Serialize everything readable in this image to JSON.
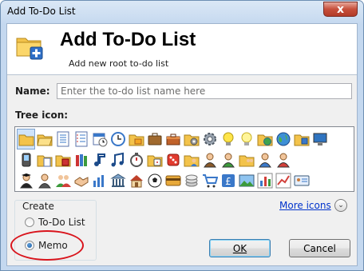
{
  "window": {
    "title": "Add To-Do List",
    "close_glyph": "x"
  },
  "header": {
    "title": "Add To-Do List",
    "subtitle": "Add new root to-do list",
    "icon": "folder-add-icon"
  },
  "form": {
    "name_label": "Name:",
    "name_value": "",
    "name_placeholder": "Enter the to-do list name here",
    "tree_icon_label": "Tree icon:"
  },
  "icon_grid": {
    "selected_index": 0,
    "icons": [
      "folder-icon",
      "folder-open-icon",
      "document-list-icon",
      "numbered-list-icon",
      "calendar-clock-icon",
      "clock-icon",
      "folder-yellow-icon",
      "briefcase-icon",
      "toolbox-icon",
      "folder-gear-icon",
      "gear-icon",
      "lightbulb-on-icon",
      "lightbulb-icon",
      "folder-globe-icon",
      "globe-icon",
      "folder-cube-icon",
      "monitor-icon",
      "spacer",
      "pda-icon",
      "folder-document-icon",
      "folder-book-icon",
      "books-icon",
      "music-note-icon",
      "music-notes-icon",
      "stopwatch-icon",
      "folder-dice-icon",
      "dice-icon",
      "folder-person-icon",
      "person-icon",
      "person-green-icon",
      "folder-people-icon",
      "person-blue-icon",
      "person-red-icon",
      "spacer",
      "spacer",
      "spacer",
      "graduate-icon",
      "person-dark-icon",
      "people-group-icon",
      "handshake-icon",
      "chart-people-icon",
      "bank-icon",
      "house-icon",
      "soccer-ball-icon",
      "credit-card-icon",
      "coins-icon",
      "shopping-cart-icon",
      "pound-icon",
      "landscape-icon",
      "bar-chart-icon",
      "line-chart-icon",
      "id-card-icon",
      "spacer",
      "spacer"
    ]
  },
  "create": {
    "group_label": "Create",
    "options": [
      {
        "label": "To-Do List",
        "checked": false
      },
      {
        "label": "Memo",
        "checked": true
      }
    ]
  },
  "more_icons": {
    "label": "More icons",
    "icon": "chevron-down-circle-icon"
  },
  "buttons": {
    "ok": "OK",
    "cancel": "Cancel"
  },
  "colors": {
    "accent": "#0033cc",
    "highlight": "#d9141c",
    "selection": "#cfe3fa"
  }
}
